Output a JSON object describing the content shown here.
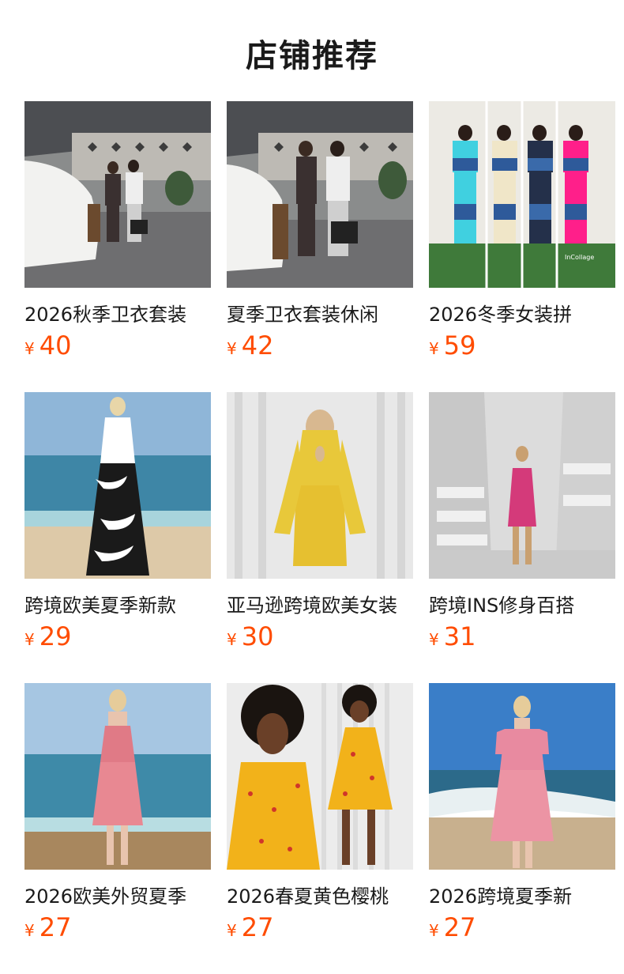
{
  "section": {
    "title": "店铺推荐"
  },
  "products": [
    {
      "name": "2026秋季卫衣套装",
      "currency": "¥",
      "price": "40",
      "image": "two-women-loungewear-parking"
    },
    {
      "name": "夏季卫衣套装休闲",
      "currency": "¥",
      "price": "42",
      "image": "two-women-loungewear-parking-alt"
    },
    {
      "name": "2026冬季女装拼",
      "currency": "¥",
      "price": "59",
      "image": "four-panel-denim-patchwork-tracksuits"
    },
    {
      "name": "跨境欧美夏季新款",
      "currency": "¥",
      "price": "29",
      "image": "woman-black-white-maxi-dress-beach"
    },
    {
      "name": "亚马逊跨境欧美女装",
      "currency": "¥",
      "price": "30",
      "image": "woman-yellow-lace-dress-white-curtain"
    },
    {
      "name": "跨境INS修身百搭",
      "currency": "¥",
      "price": "31",
      "image": "woman-pink-slip-dress-white-interior"
    },
    {
      "name": "2026欧美外贸夏季",
      "currency": "¥",
      "price": "27",
      "image": "woman-pink-floral-dress-beach"
    },
    {
      "name": "2026春夏黄色樱桃",
      "currency": "¥",
      "price": "27",
      "image": "two-women-yellow-cherry-dresses"
    },
    {
      "name": "2026跨境夏季新",
      "currency": "¥",
      "price": "27",
      "image": "woman-pink-floral-puff-sleeve-beach"
    }
  ],
  "image_overlay_text": "InCollage"
}
